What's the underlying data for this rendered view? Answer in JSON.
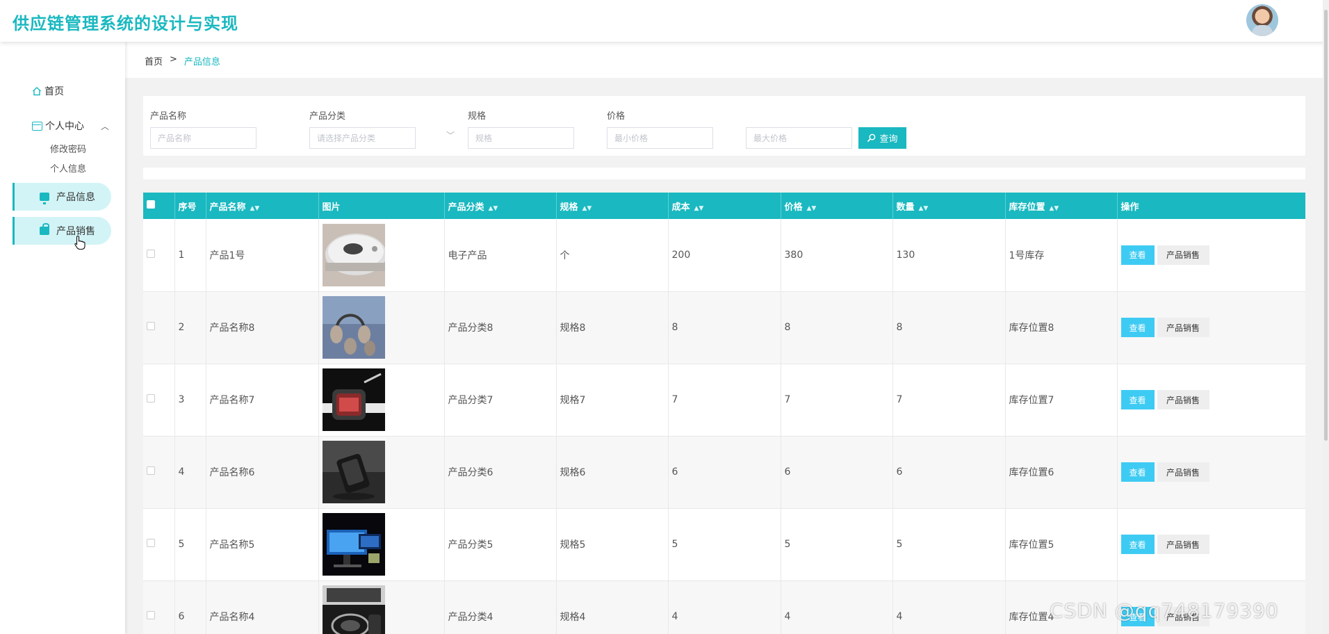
{
  "header": {
    "title": "供应链管理系统的设计与实现"
  },
  "sidebar": {
    "home": "首页",
    "personal": "个人中心",
    "sub_items": [
      "修改密码",
      "个人信息"
    ],
    "menu": [
      "产品信息",
      "产品销售"
    ]
  },
  "breadcrumb": {
    "home": "首页",
    "sep": ">",
    "current": "产品信息"
  },
  "search": {
    "fields": [
      {
        "label": "产品名称",
        "placeholder": "产品名称"
      },
      {
        "label": "产品分类",
        "placeholder": "请选择产品分类"
      },
      {
        "label": "规格",
        "placeholder": "规格"
      },
      {
        "label": "价格",
        "placeholder": "最小价格"
      },
      {
        "label": "",
        "placeholder": "最大价格"
      }
    ],
    "button": "查询"
  },
  "table": {
    "headers": [
      "序号",
      "产品名称",
      "图片",
      "产品分类",
      "规格",
      "成本",
      "价格",
      "数量",
      "库存位置",
      "操作"
    ],
    "view_label": "查看",
    "sale_label": "产品销售",
    "rows": [
      {
        "idx": "1",
        "name": "产品1号",
        "category": "电子产品",
        "spec": "个",
        "cost": "200",
        "price": "380",
        "qty": "130",
        "location": "1号库存",
        "img": "robot-vacuum"
      },
      {
        "idx": "2",
        "name": "产品名称8",
        "category": "产品分类8",
        "spec": "规格8",
        "cost": "8",
        "price": "8",
        "qty": "8",
        "location": "库存位置8",
        "img": "headphones"
      },
      {
        "idx": "3",
        "name": "产品名称7",
        "category": "产品分类7",
        "spec": "规格7",
        "cost": "7",
        "price": "7",
        "qty": "7",
        "location": "库存位置7",
        "img": "smartwatch"
      },
      {
        "idx": "4",
        "name": "产品名称6",
        "category": "产品分类6",
        "spec": "规格6",
        "cost": "6",
        "price": "6",
        "qty": "6",
        "location": "库存位置6",
        "img": "device-dark"
      },
      {
        "idx": "5",
        "name": "产品名称5",
        "category": "产品分类5",
        "spec": "规格5",
        "cost": "5",
        "price": "5",
        "qty": "5",
        "location": "库存位置5",
        "img": "monitor"
      },
      {
        "idx": "6",
        "name": "产品名称4",
        "category": "产品分类4",
        "spec": "规格4",
        "cost": "4",
        "price": "4",
        "qty": "4",
        "location": "库存位置4",
        "img": "laptop"
      }
    ]
  },
  "watermark": "CSDN @qq748179390",
  "colors": {
    "accent": "#1ab8c0",
    "view_button": "#3ecbf3",
    "pill_bg": "#d3f4f6"
  }
}
